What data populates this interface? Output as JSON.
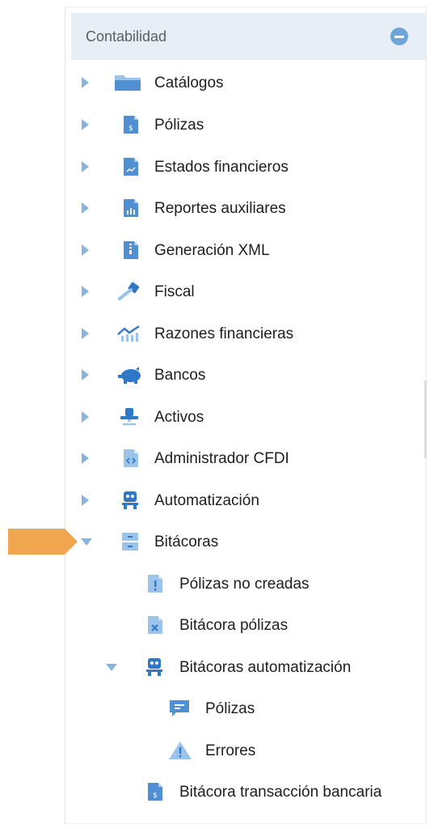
{
  "panel": {
    "title": "Contabilidad",
    "collapse_icon": "minus-circle-icon"
  },
  "menu": {
    "items": [
      {
        "label": "Catálogos",
        "icon": "folder-icon",
        "state": "collapsed"
      },
      {
        "label": "Pólizas",
        "icon": "dollar-document-icon",
        "state": "collapsed"
      },
      {
        "label": "Estados financieros",
        "icon": "chart-document-icon",
        "state": "collapsed"
      },
      {
        "label": "Reportes auxiliares",
        "icon": "bar-chart-document-icon",
        "state": "collapsed"
      },
      {
        "label": "Generación XML",
        "icon": "xml-document-icon",
        "state": "collapsed"
      },
      {
        "label": "Fiscal",
        "icon": "gavel-icon",
        "state": "collapsed"
      },
      {
        "label": "Razones financieras",
        "icon": "trend-chart-icon",
        "state": "collapsed"
      },
      {
        "label": "Bancos",
        "icon": "piggy-bank-icon",
        "state": "collapsed"
      },
      {
        "label": "Activos",
        "icon": "office-chair-icon",
        "state": "collapsed"
      },
      {
        "label": "Administrador CFDI",
        "icon": "code-document-icon",
        "state": "collapsed"
      },
      {
        "label": "Automatización",
        "icon": "robot-icon",
        "state": "collapsed"
      },
      {
        "label": "Bitácoras",
        "icon": "archive-drawer-icon",
        "state": "expanded"
      }
    ],
    "bitacoras_children": [
      {
        "label": "Pólizas no creadas",
        "icon": "warning-document-icon"
      },
      {
        "label": "Bitácora pólizas",
        "icon": "x-document-icon"
      },
      {
        "label": "Bitácoras automatización",
        "icon": "robot-icon",
        "state": "expanded"
      },
      {
        "label": "Bitácora transacción bancaria",
        "icon": "dollar-document-icon"
      }
    ],
    "automatizacion_children": [
      {
        "label": "Pólizas",
        "icon": "message-icon"
      },
      {
        "label": "Errores",
        "icon": "warning-triangle-icon"
      }
    ]
  },
  "colors": {
    "header_bg": "#e8eef5",
    "accent_blue": "#6ea4d8",
    "pointer_orange": "#f0a64e"
  }
}
